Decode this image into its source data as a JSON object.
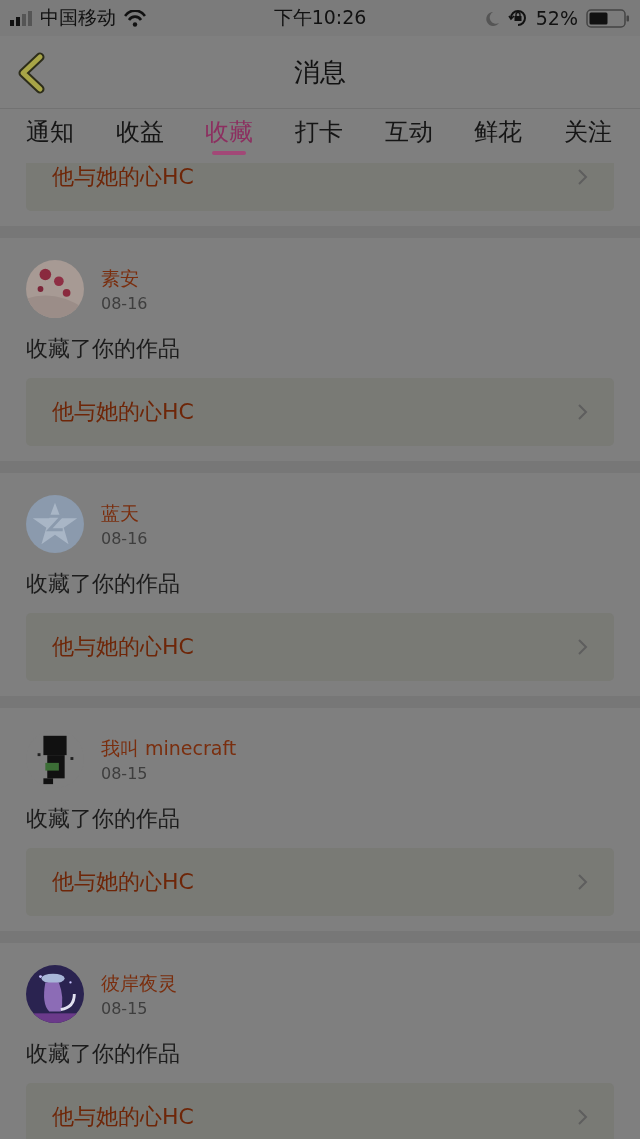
{
  "status_bar": {
    "carrier": "中国移动",
    "time": "下午10:26",
    "battery": "52%"
  },
  "nav": {
    "title": "消息"
  },
  "tabs": [
    {
      "label": "通知",
      "selected": false
    },
    {
      "label": "收益",
      "selected": false
    },
    {
      "label": "收藏",
      "selected": true
    },
    {
      "label": "打卡",
      "selected": false
    },
    {
      "label": "互动",
      "selected": false
    },
    {
      "label": "鲜花",
      "selected": false
    },
    {
      "label": "关注",
      "selected": false
    }
  ],
  "messages": [
    {
      "link": "他与她的心HC"
    },
    {
      "user": "素安",
      "date": "08-16",
      "action": "收藏了你的作品",
      "link": "他与她的心HC"
    },
    {
      "user": "蓝天",
      "date": "08-16",
      "action": "收藏了你的作品",
      "link": "他与她的心HC"
    },
    {
      "user": "我叫 minecraft",
      "date": "08-15",
      "action": "收藏了你的作品",
      "link": "他与她的心HC"
    },
    {
      "user": "彼岸夜灵",
      "date": "08-15",
      "action": "收藏了你的作品",
      "link": "他与她的心HC"
    }
  ]
}
